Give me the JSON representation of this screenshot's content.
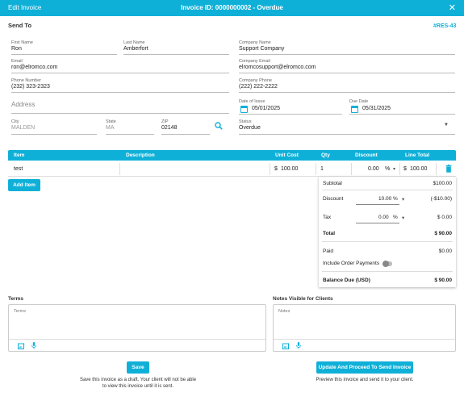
{
  "titlebar": {
    "left": "Edit Invoice",
    "center": "Invoice ID: 0000000002 - Overdue",
    "close": "✕"
  },
  "send_to": {
    "title": "Send To",
    "tag": "#RES-43"
  },
  "fields": {
    "first_name": {
      "label": "First Name",
      "value": "Ron"
    },
    "last_name": {
      "label": "Last Name",
      "value": "Amberfort"
    },
    "company_name": {
      "label": "Company Name",
      "value": "Support Company"
    },
    "email": {
      "label": "Email",
      "value": "ron@elromco.com"
    },
    "company_email": {
      "label": "Company Email",
      "value": "elromcosupport@elromco.com"
    },
    "phone": {
      "label": "Phone Number",
      "value": "(232) 323-2323"
    },
    "company_phone": {
      "label": "Company Phone",
      "value": "(222) 222-2222"
    },
    "address": {
      "placeholder": "Address"
    },
    "date_of_issue": {
      "label": "Date of Issue",
      "value": "05/01/2025"
    },
    "due_date": {
      "label": "Due Date",
      "value": "05/31/2025"
    },
    "city": {
      "label": "City",
      "value": "MALDEN"
    },
    "state": {
      "label": "State",
      "value": "MA"
    },
    "zip": {
      "label": "ZIP",
      "value": "02148"
    },
    "status": {
      "label": "Status",
      "value": "Overdue"
    }
  },
  "table": {
    "headers": {
      "item": "Item",
      "description": "Description",
      "unit_cost": "Unit Cost",
      "qty": "Qty",
      "discount": "Discount",
      "line_total": "Line Total"
    },
    "rows": [
      {
        "item": "test",
        "description": "",
        "currency": "$",
        "unit_cost": "100.00",
        "qty": "1",
        "discount": "0.00",
        "pct": "%",
        "line_currency": "$",
        "line_total": "100.00"
      }
    ]
  },
  "add_item": "Add Item",
  "summary": {
    "subtotal_label": "Subtotal",
    "subtotal_value": "$100.00",
    "discount_label": "Discount",
    "discount_input": "10.00",
    "discount_pct": "%",
    "discount_value": "(-$10.00)",
    "tax_label": "Tax",
    "tax_input": "0.00",
    "tax_pct": "%",
    "tax_value": "$ 0.00",
    "total_label": "Total",
    "total_value": "$ 90.00",
    "paid_label": "Paid",
    "paid_value": "$0.00",
    "include_label": "Include Order Payments",
    "balance_label": "Balance Due (USD)",
    "balance_value": "$ 90.00"
  },
  "terms": {
    "title": "Terms",
    "placeholder": "Terms"
  },
  "notes": {
    "title": "Notes Visible for Clients",
    "placeholder": "Notes"
  },
  "actions": {
    "save": "Save",
    "save_hint_1": "Save this invoice as a draft. Your client will not be able",
    "save_hint_2": "to view this invoice until it is sent.",
    "send": "Update And Proceed To Send Invoice",
    "send_hint": "Preview this invoice and send it to your client."
  },
  "colors": {
    "accent": "#0fb0d8",
    "danger": "#0fb0d8"
  }
}
